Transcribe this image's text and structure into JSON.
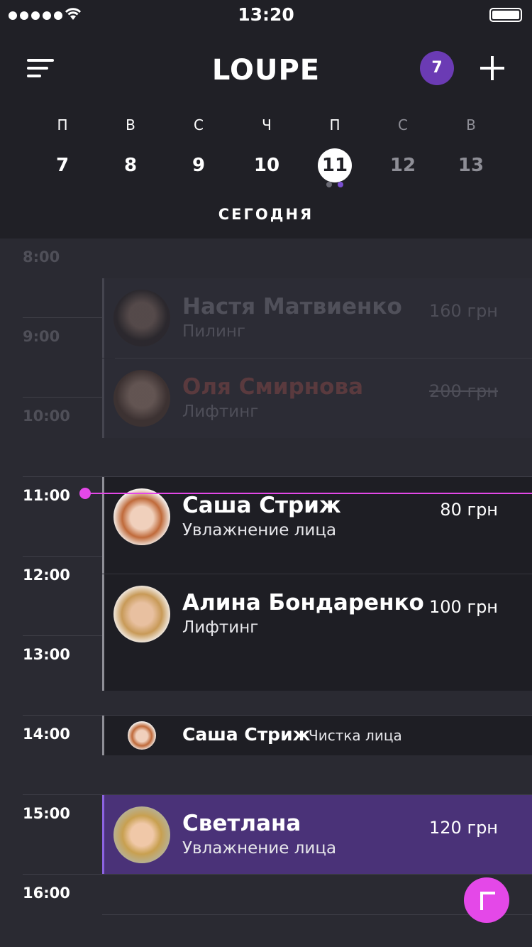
{
  "status_bar": {
    "time": "13:20"
  },
  "header": {
    "logo": "LOUPE",
    "badge_count": "7"
  },
  "week": [
    {
      "letter": "П",
      "num": "7",
      "state": "normal"
    },
    {
      "letter": "В",
      "num": "8",
      "state": "normal"
    },
    {
      "letter": "С",
      "num": "9",
      "state": "normal"
    },
    {
      "letter": "Ч",
      "num": "10",
      "state": "normal"
    },
    {
      "letter": "П",
      "num": "11",
      "state": "selected"
    },
    {
      "letter": "С",
      "num": "12",
      "state": "weekend"
    },
    {
      "letter": "В",
      "num": "13",
      "state": "weekend"
    }
  ],
  "today_label": "СЕГОДНЯ",
  "hours": [
    "8:00",
    "9:00",
    "10:00",
    "11:00",
    "12:00",
    "13:00",
    "14:00",
    "15:00",
    "16:00"
  ],
  "appointments": [
    {
      "name": "Настя Матвиенко",
      "service": "Пилинг",
      "price": "160 грн",
      "state": "past"
    },
    {
      "name": "Оля Смирнова",
      "service": "Лифтинг",
      "price": "200 грн",
      "state": "cancelled"
    },
    {
      "name": "Саша Стриж",
      "service": "Увлажнение лица",
      "price": "80 грн",
      "state": "upcoming"
    },
    {
      "name": "Алина Бондаренко",
      "service": "Лифтинг",
      "price": "100 грн",
      "state": "upcoming"
    },
    {
      "name": "Саша Стриж",
      "service": "Чистка лица",
      "state": "upcoming"
    },
    {
      "name": "Светлана",
      "service": "Увлажнение лица",
      "price": "120 грн",
      "state": "highlighted"
    }
  ],
  "colors": {
    "accent": "#6b3bb4",
    "now_line": "#e448e8",
    "highlight": "#4a3278"
  },
  "icons": {
    "menu": "sort-lines-icon",
    "add": "plus-icon",
    "fab": "corner-arrow-icon"
  }
}
